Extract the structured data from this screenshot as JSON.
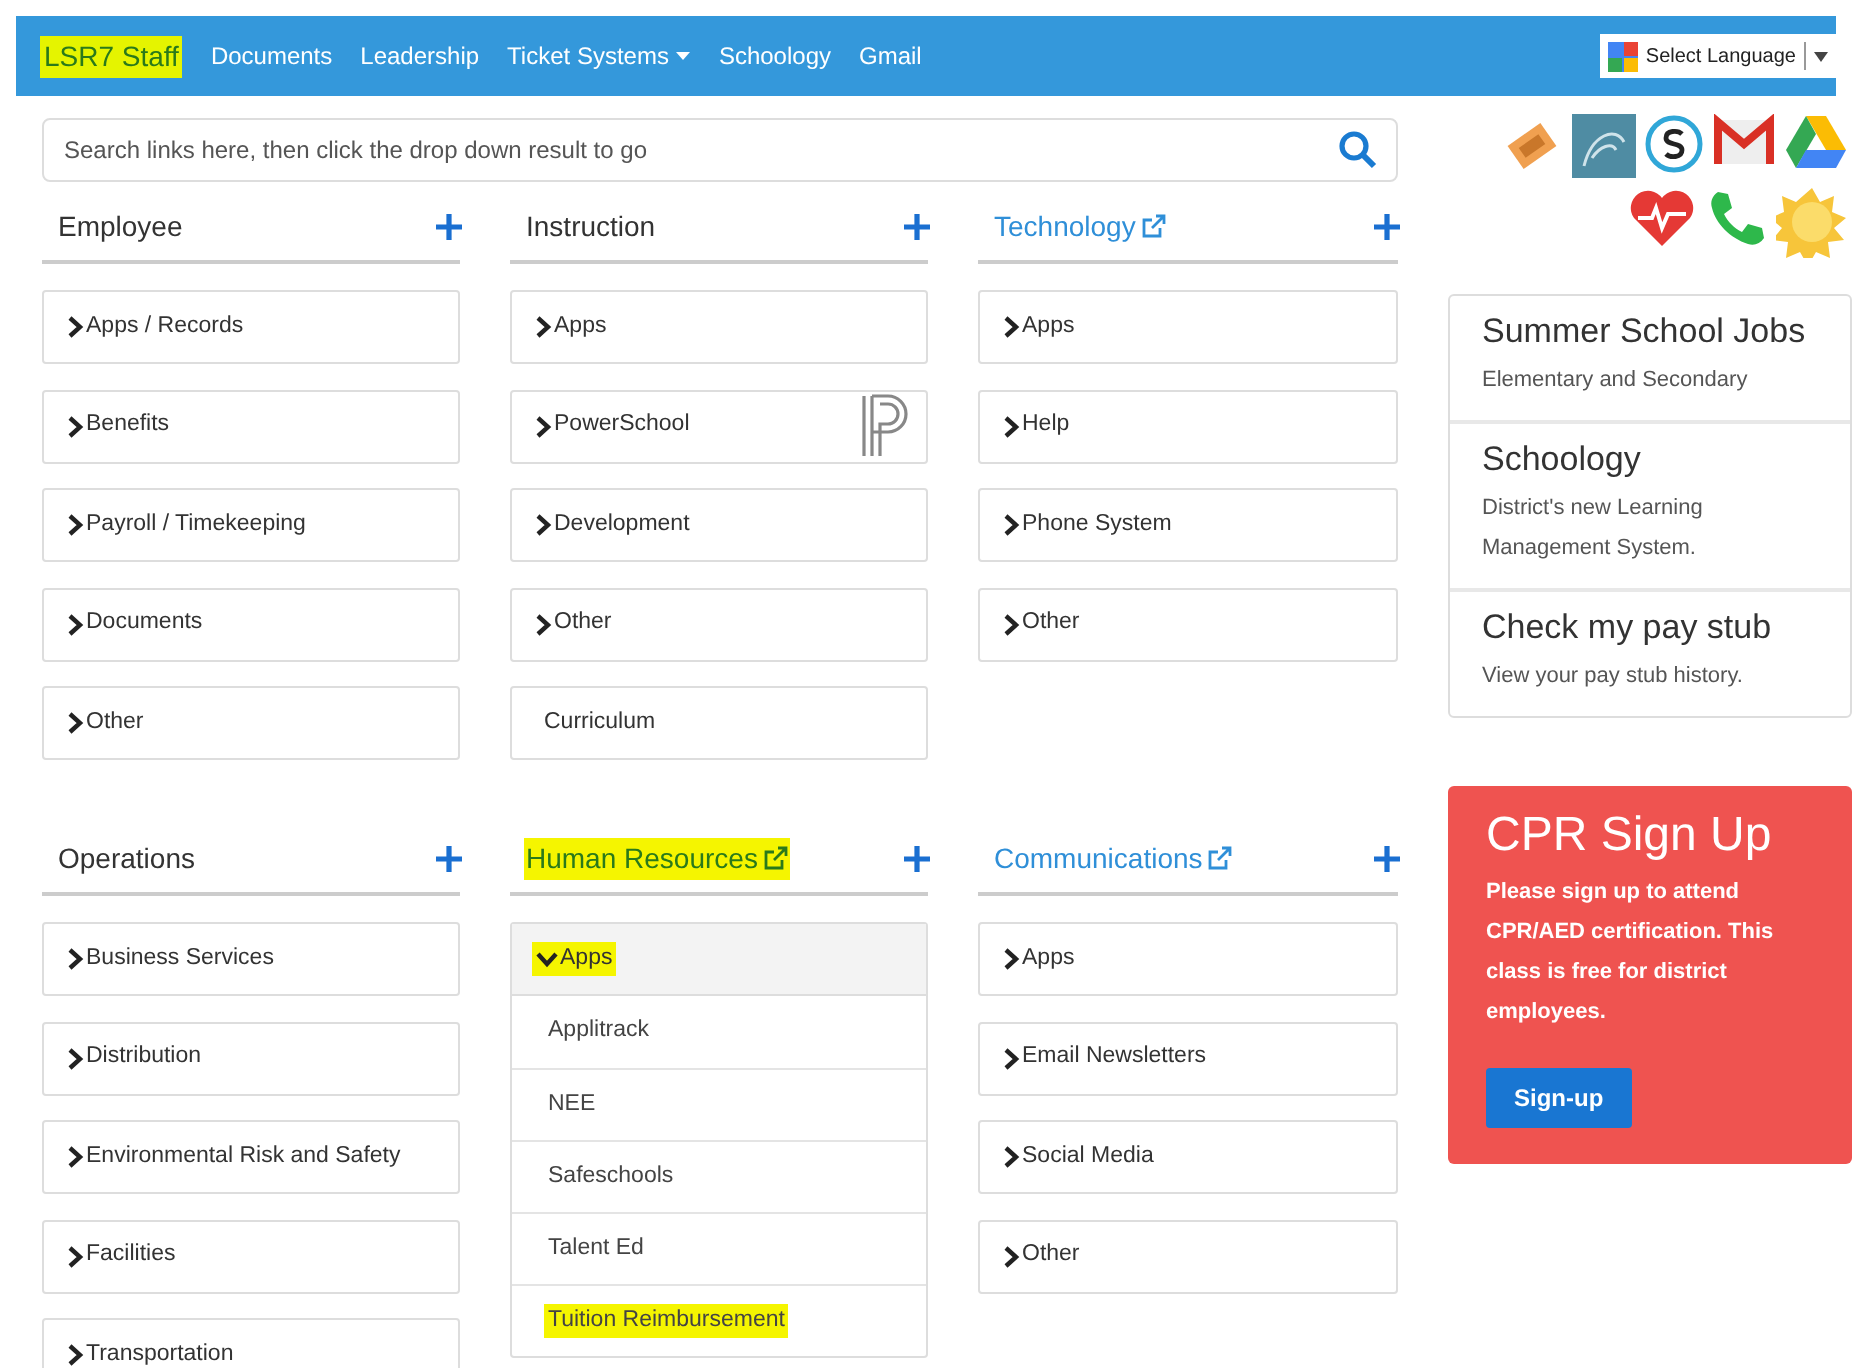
{
  "navbar": {
    "brand": "LSR7 Staff",
    "brand_highlighted": true,
    "links": [
      {
        "label": "Documents",
        "dropdown": false
      },
      {
        "label": "Leadership",
        "dropdown": false
      },
      {
        "label": "Ticket Systems",
        "dropdown": true
      },
      {
        "label": "Schoology",
        "dropdown": false
      },
      {
        "label": "Gmail",
        "dropdown": false
      }
    ],
    "language": "Select Language"
  },
  "search": {
    "placeholder": "Search links here, then click the drop down result to go"
  },
  "sections": [
    {
      "title": "Employee",
      "external": false,
      "highlighted": false,
      "items": [
        {
          "label": "Apps / Records",
          "kind": "collapsed"
        },
        {
          "label": "Benefits",
          "kind": "collapsed"
        },
        {
          "label": "Payroll / Timekeeping",
          "kind": "collapsed"
        },
        {
          "label": "Documents",
          "kind": "collapsed"
        },
        {
          "label": "Other",
          "kind": "collapsed"
        }
      ]
    },
    {
      "title": "Instruction",
      "external": false,
      "highlighted": false,
      "items": [
        {
          "label": "Apps",
          "kind": "collapsed"
        },
        {
          "label": "PowerSchool",
          "kind": "collapsed",
          "logo": true
        },
        {
          "label": "Development",
          "kind": "collapsed"
        },
        {
          "label": "Other",
          "kind": "collapsed"
        },
        {
          "label": "Curriculum",
          "kind": "plain"
        }
      ]
    },
    {
      "title": "Technology",
      "external": true,
      "highlighted": false,
      "items": [
        {
          "label": "Apps",
          "kind": "collapsed"
        },
        {
          "label": "Help",
          "kind": "collapsed"
        },
        {
          "label": "Phone System",
          "kind": "collapsed"
        },
        {
          "label": "Other",
          "kind": "collapsed"
        }
      ]
    },
    {
      "title": "Operations",
      "external": false,
      "highlighted": false,
      "items": [
        {
          "label": "Business Services",
          "kind": "collapsed"
        },
        {
          "label": "Distribution",
          "kind": "collapsed"
        },
        {
          "label": "Environmental Risk and Safety",
          "kind": "collapsed"
        },
        {
          "label": "Facilities",
          "kind": "collapsed"
        },
        {
          "label": "Transportation",
          "kind": "collapsed"
        }
      ]
    },
    {
      "title": "Human Resources",
      "external": true,
      "highlighted": true,
      "items": [
        {
          "label": "Apps",
          "kind": "expanded",
          "highlighted": true,
          "children": [
            {
              "label": "Applitrack",
              "highlighted": false
            },
            {
              "label": "NEE",
              "highlighted": false
            },
            {
              "label": "Safeschools",
              "highlighted": false
            },
            {
              "label": "Talent Ed",
              "highlighted": false
            },
            {
              "label": "Tuition Reimbursement",
              "highlighted": true
            }
          ]
        }
      ]
    },
    {
      "title": "Communications",
      "external": true,
      "highlighted": false,
      "items": [
        {
          "label": "Apps",
          "kind": "collapsed"
        },
        {
          "label": "Email Newsletters",
          "kind": "collapsed"
        },
        {
          "label": "Social Media",
          "kind": "collapsed"
        },
        {
          "label": "Other",
          "kind": "collapsed"
        }
      ]
    }
  ],
  "quick_cards": [
    {
      "title": "Summer School Jobs",
      "text": "Elementary and Secondary"
    },
    {
      "title": "Schoology",
      "text": "District's new Learning Management System."
    },
    {
      "title": "Check my pay stub",
      "text": "View your pay stub history."
    }
  ],
  "promo": {
    "title": "CPR Sign Up",
    "text": "Please sign up to attend CPR/AED certification. This class is free for district employees.",
    "button": "Sign-up"
  }
}
